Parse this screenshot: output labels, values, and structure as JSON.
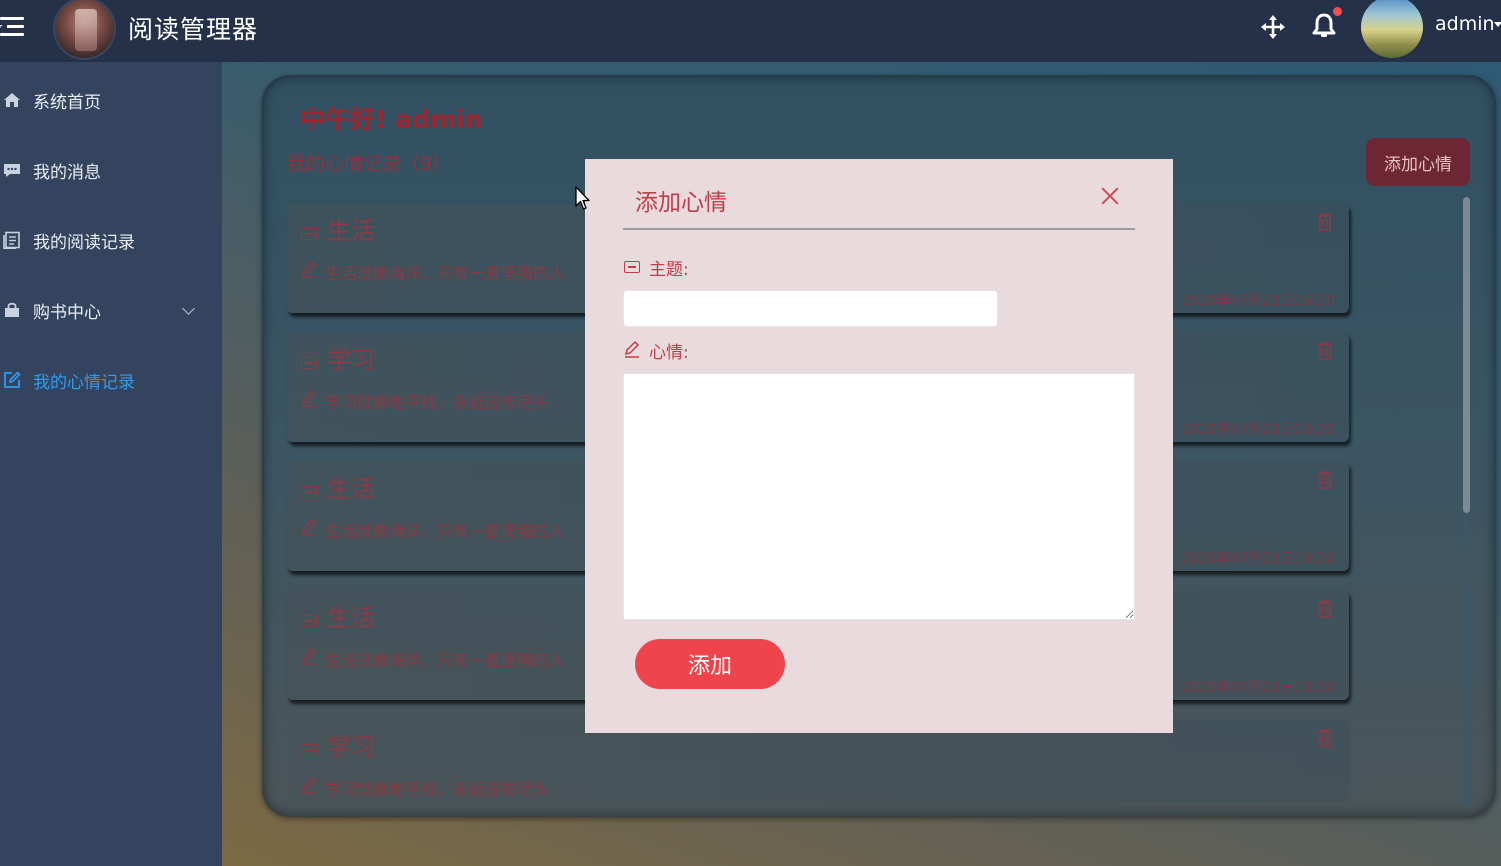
{
  "header": {
    "app_title": "阅读管理器",
    "username": "admin",
    "icons": [
      "menu-toggle-icon",
      "logo",
      "move-icon",
      "bell-icon",
      "avatar"
    ]
  },
  "sidebar": {
    "items": [
      {
        "label": "系统首页",
        "icon": "home-icon"
      },
      {
        "label": "我的消息",
        "icon": "message-icon"
      },
      {
        "label": "我的阅读记录",
        "icon": "reading-record-icon"
      },
      {
        "label": "购书中心",
        "icon": "shop-icon",
        "has_submenu": true
      },
      {
        "label": "我的心情记录",
        "icon": "edit-icon",
        "active": true
      }
    ]
  },
  "main": {
    "greeting": "中午好! admin",
    "record_count": "我的心情记录（9）",
    "add_button": "添加心情",
    "cards": [
      {
        "title": "生活",
        "text": "生活就像海洋，只有一直坚强的人",
        "date": "2020年07月21日16:20"
      },
      {
        "title": "学习",
        "text": "学习就像地平线，永远没有尽头",
        "date": "2020年07月21日16:20"
      },
      {
        "title": "生活",
        "text": "生活就像海洋，只有一直坚强的人",
        "date": "2020年07月21日16:20"
      },
      {
        "title": "生活",
        "text": "生活就像海洋，只有一直坚强的人",
        "date": "2020年07月21日16:20"
      },
      {
        "title": "学习",
        "text": "学习就像地平线，永远没有尽头",
        "date": ""
      }
    ]
  },
  "modal": {
    "title": "添加心情",
    "subject_label": "主题:",
    "subject_value": "",
    "mood_label": "心情:",
    "mood_value": "",
    "submit_label": "添加"
  },
  "colors": {
    "accent_red": "#f0444c",
    "active_nav": "#2f9cf3",
    "sidebar_bg": "#34445e",
    "topbar_bg": "#243148",
    "modal_bg": "#e8dadd"
  }
}
